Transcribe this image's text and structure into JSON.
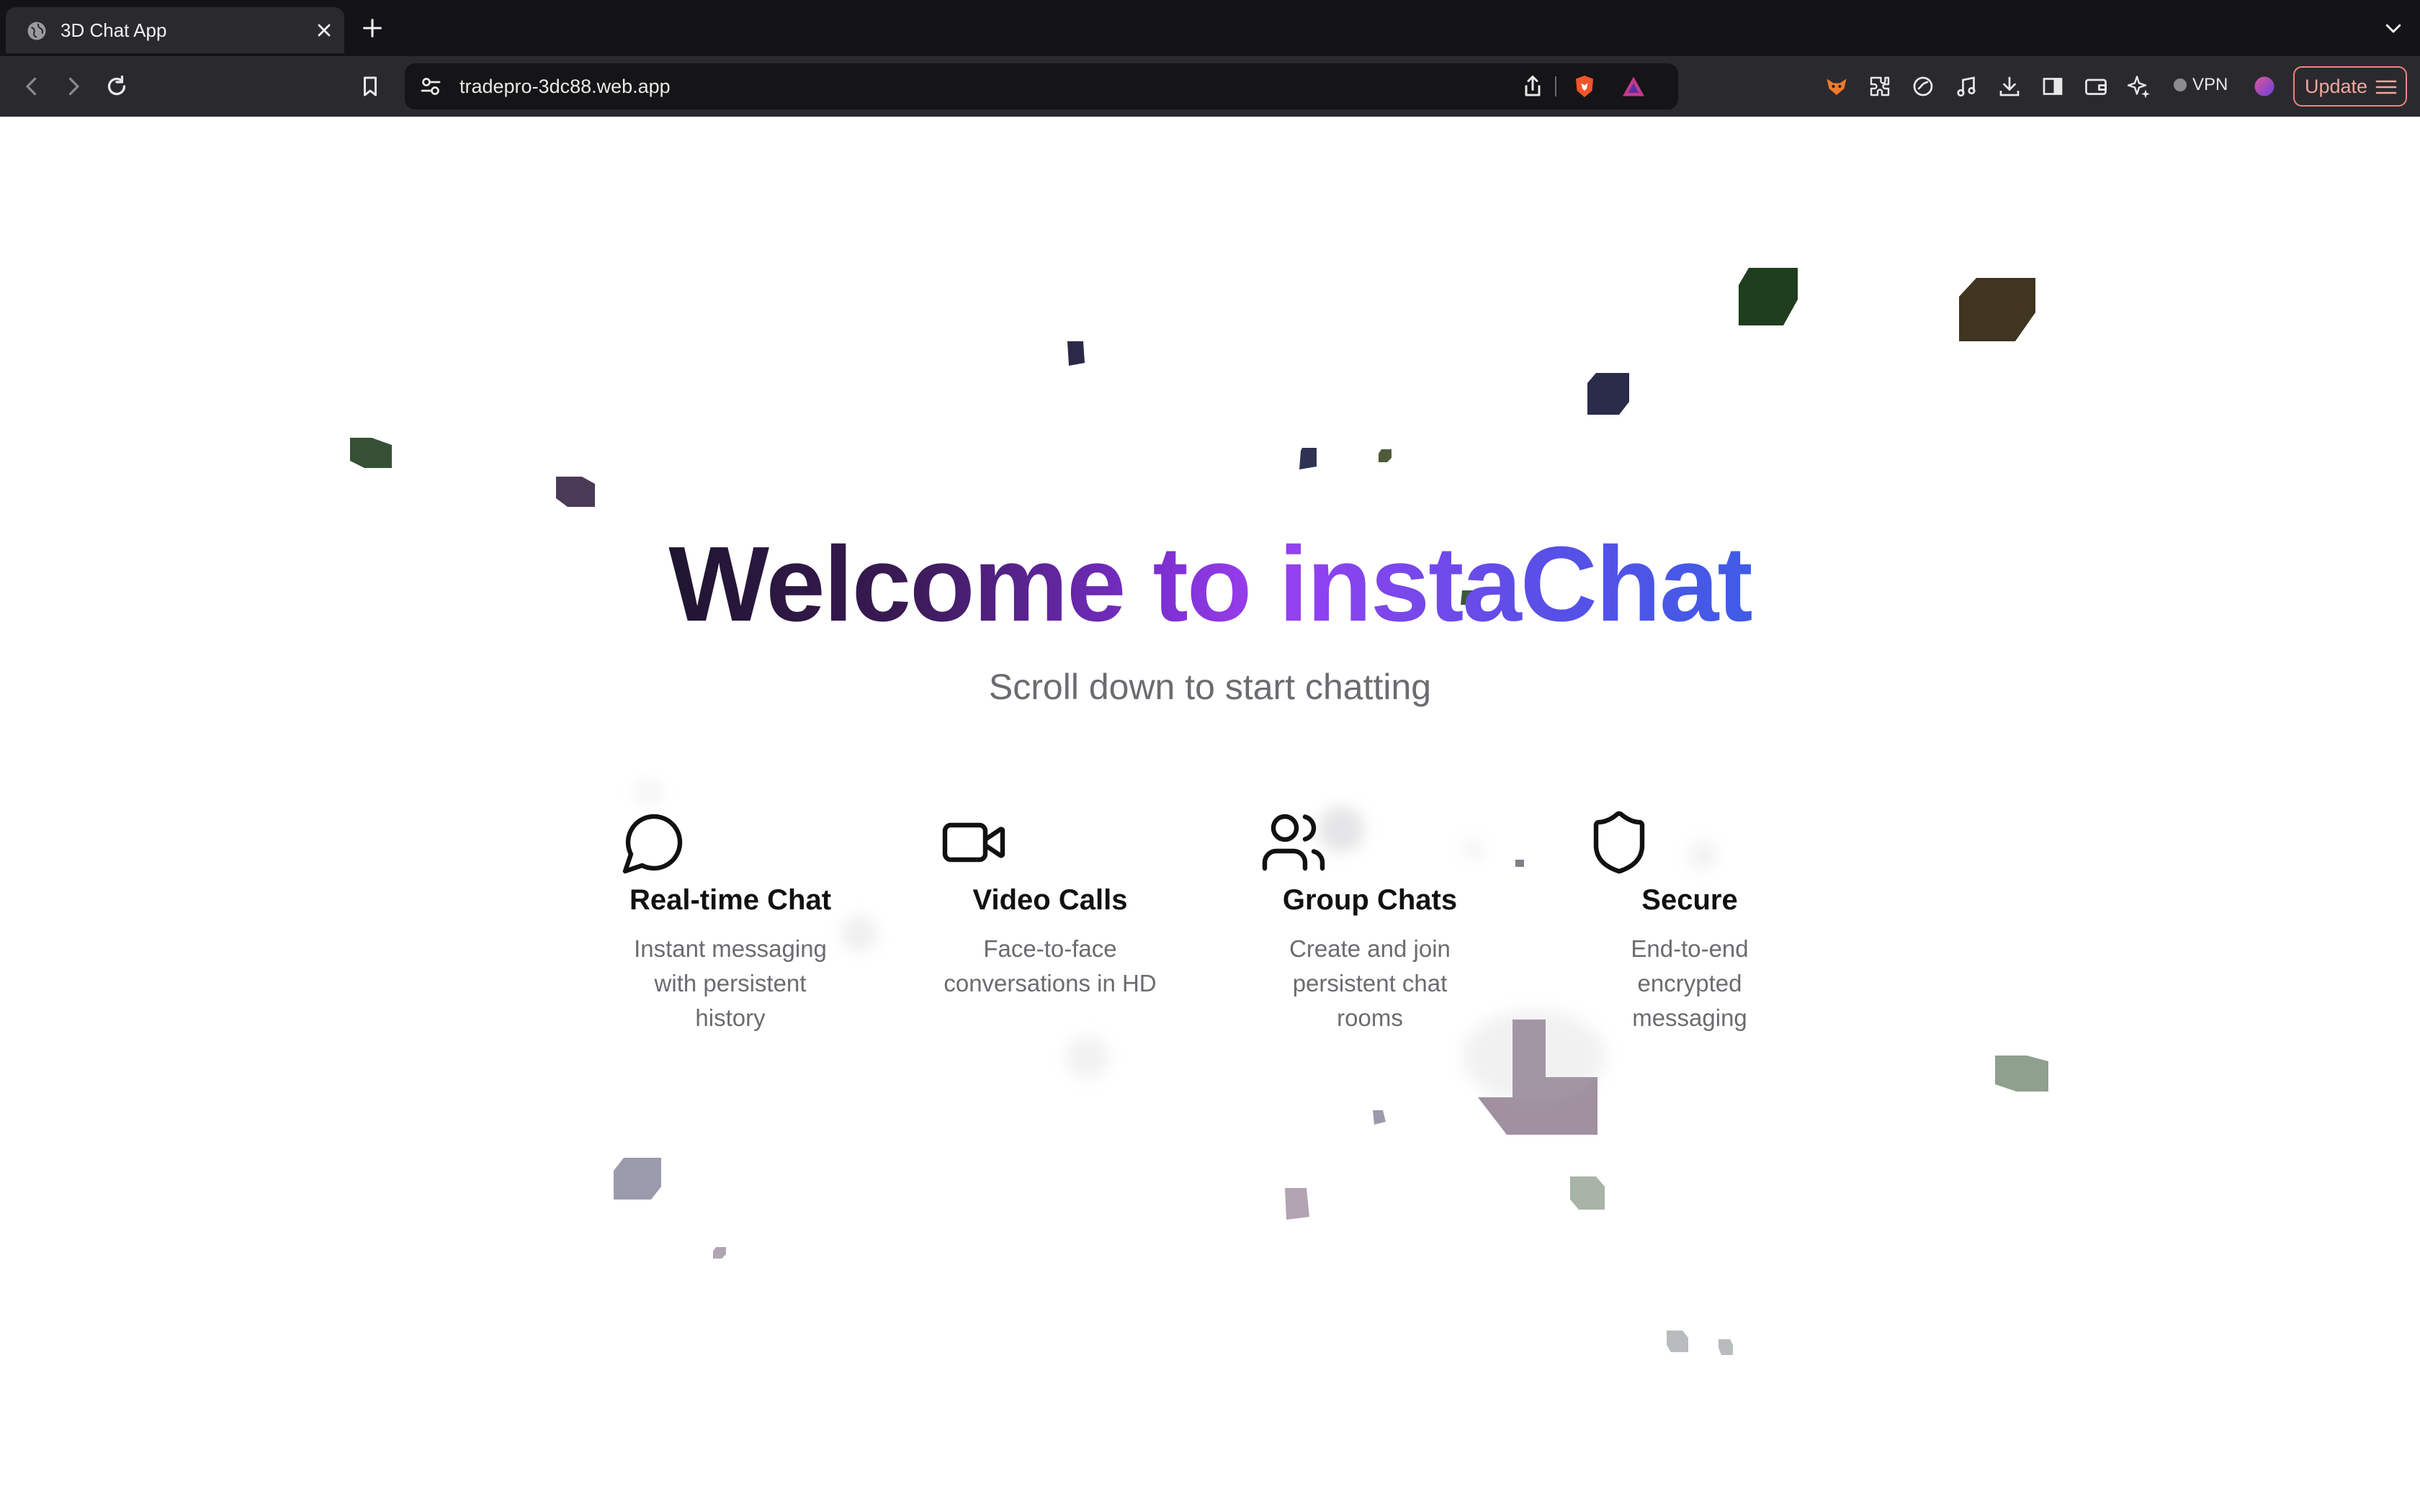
{
  "browser": {
    "tab": {
      "title": "3D Chat App"
    },
    "address_bar": {
      "url": "tradepro-3dc88.web.app"
    },
    "vpn_label": "VPN",
    "update_label": "Update"
  },
  "hero": {
    "title": "Welcome to instaChat",
    "subtitle": "Scroll down to start chatting"
  },
  "features": [
    {
      "icon": "chat-bubble-icon",
      "title": "Real-time Chat",
      "description": "Instant messaging with persistent history"
    },
    {
      "icon": "video-camera-icon",
      "title": "Video Calls",
      "description": "Face-to-face conversations in HD"
    },
    {
      "icon": "users-icon",
      "title": "Group Chats",
      "description": "Create and join persistent chat rooms"
    },
    {
      "icon": "shield-icon",
      "title": "Secure",
      "description": "End-to-end encrypted messaging"
    }
  ],
  "colors": {
    "browser_bg": "#141417",
    "toolbar_bg": "#2a2a2e",
    "update_accent": "#e9877f",
    "title_gradient_start": "#1f1530",
    "title_gradient_mid": "#9b3ff0",
    "title_gradient_end": "#3f5ce6"
  }
}
